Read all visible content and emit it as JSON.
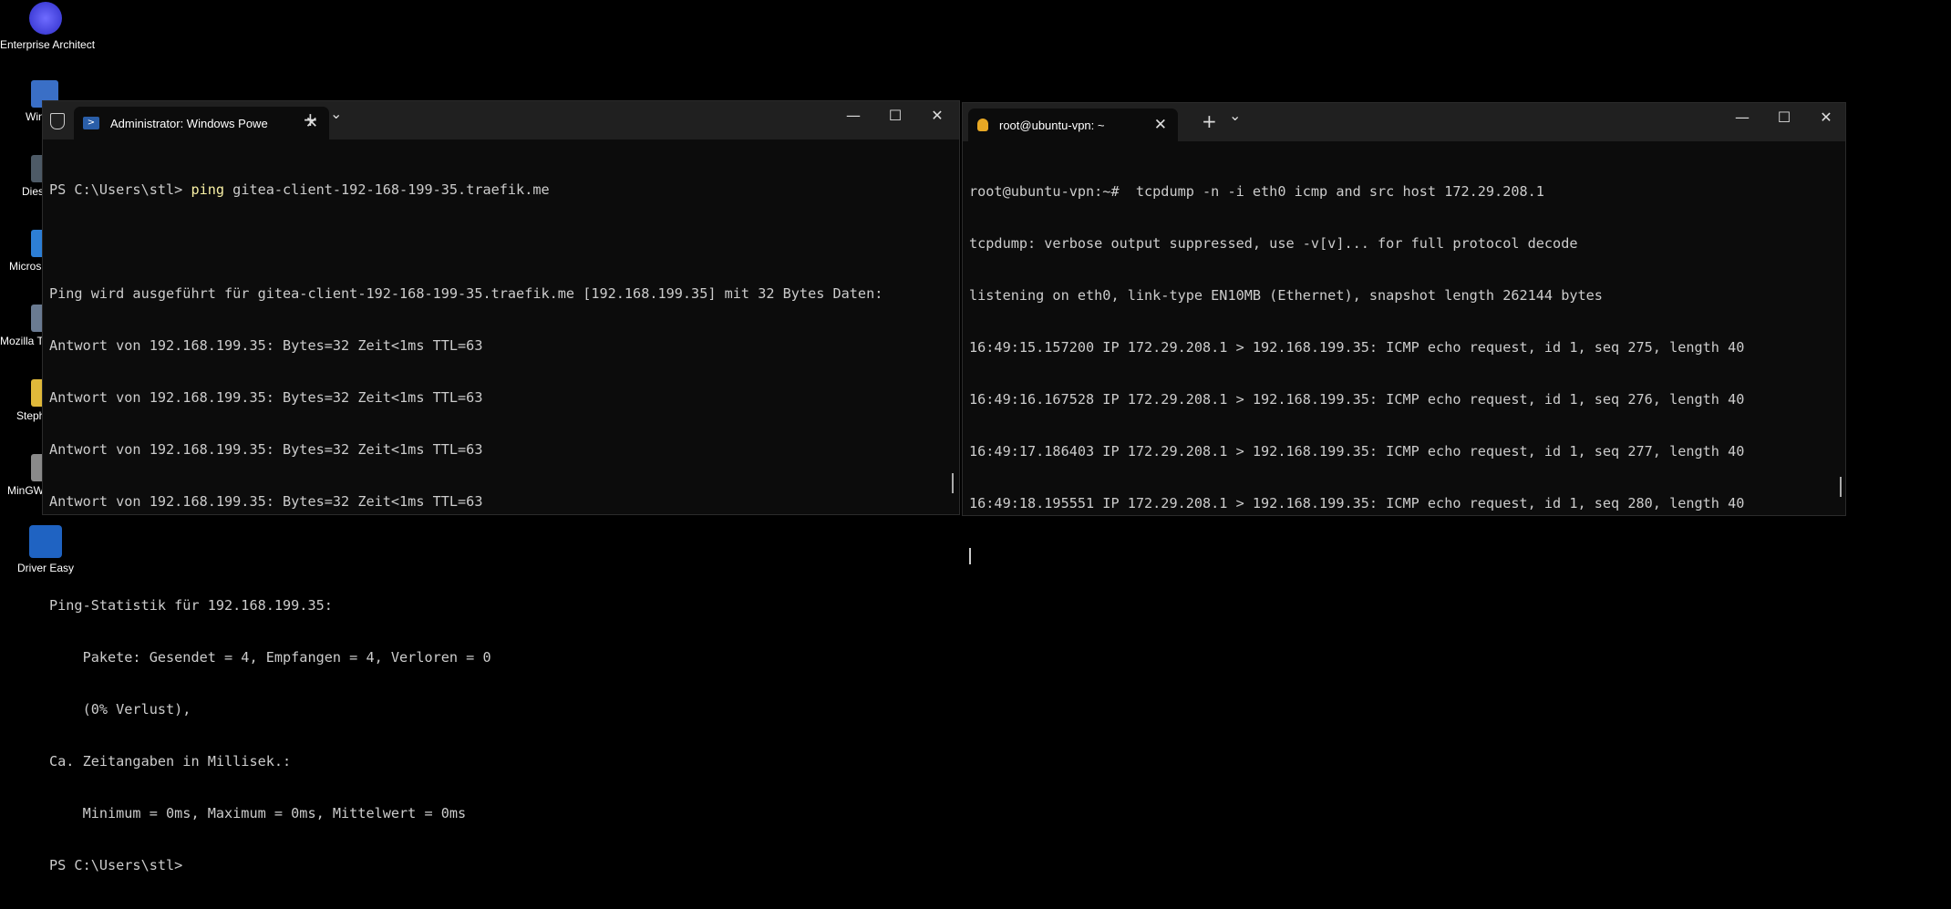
{
  "desktop": {
    "icons": [
      {
        "name": "enterprise-architect",
        "label": "Enterprise Architect"
      },
      {
        "name": "driver-easy",
        "label": "Driver Easy"
      }
    ],
    "partial_labels": [
      "Win",
      "Dies",
      "Micros",
      "Mozilla T",
      "Steph",
      "MinGW"
    ]
  },
  "powershell": {
    "tab_title": "Administrator: Windows Powe",
    "lines": [
      {
        "prompt": "PS C:\\Users\\stl> ",
        "cmd": "ping",
        "args": " gitea-client-192-168-199-35.traefik.me"
      },
      {
        "text": ""
      },
      {
        "text": "Ping wird ausgeführt für gitea-client-192-168-199-35.traefik.me [192.168.199.35] mit 32 Bytes Daten:"
      },
      {
        "text": "Antwort von 192.168.199.35: Bytes=32 Zeit<1ms TTL=63"
      },
      {
        "text": "Antwort von 192.168.199.35: Bytes=32 Zeit<1ms TTL=63"
      },
      {
        "text": "Antwort von 192.168.199.35: Bytes=32 Zeit<1ms TTL=63"
      },
      {
        "text": "Antwort von 192.168.199.35: Bytes=32 Zeit<1ms TTL=63"
      },
      {
        "text": ""
      },
      {
        "text": "Ping-Statistik für 192.168.199.35:"
      },
      {
        "text": "    Pakete: Gesendet = 4, Empfangen = 4, Verloren = 0"
      },
      {
        "text": "    (0% Verlust),"
      },
      {
        "text": "Ca. Zeitangaben in Millisek.:"
      },
      {
        "text": "    Minimum = 0ms, Maximum = 0ms, Mittelwert = 0ms"
      },
      {
        "text": "PS C:\\Users\\stl>"
      }
    ]
  },
  "ubuntu": {
    "tab_title": "root@ubuntu-vpn: ~",
    "lines": [
      "root@ubuntu-vpn:~#  tcpdump -n -i eth0 icmp and src host 172.29.208.1",
      "tcpdump: verbose output suppressed, use -v[v]... for full protocol decode",
      "listening on eth0, link-type EN10MB (Ethernet), snapshot length 262144 bytes",
      "16:49:15.157200 IP 172.29.208.1 > 192.168.199.35: ICMP echo request, id 1, seq 275, length 40",
      "16:49:16.167528 IP 172.29.208.1 > 192.168.199.35: ICMP echo request, id 1, seq 276, length 40",
      "16:49:17.186403 IP 172.29.208.1 > 192.168.199.35: ICMP echo request, id 1, seq 277, length 40",
      "16:49:18.195551 IP 172.29.208.1 > 192.168.199.35: ICMP echo request, id 1, seq 280, length 40"
    ]
  },
  "window_controls": {
    "minimize": "—",
    "maximize": "☐",
    "close": "✕",
    "new_tab": "+",
    "dropdown": "⌄"
  }
}
